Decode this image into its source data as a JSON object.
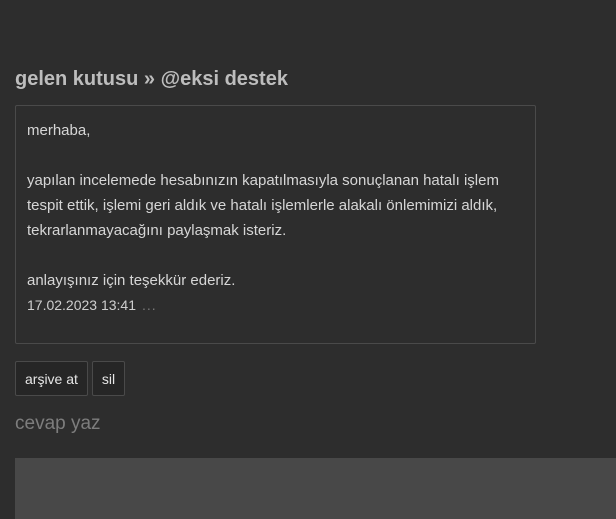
{
  "header": {
    "title": "gelen kutusu » @eksi destek"
  },
  "message": {
    "greeting": "merhaba,",
    "body_lines": [
      "yapılan incelemede hesabınızın kapatılmasıyla sonuçlanan hatalı işlem",
      "tespit ettik, işlemi geri aldık ve hatalı işlemlerle alakalı önlemimizi aldık,",
      "tekrarlanmayacağını paylaşmak isteriz."
    ],
    "closing": "anlayışınız için teşekkür ederiz.",
    "timestamp": "17.02.2023 13:41",
    "more": "..."
  },
  "actions": {
    "archive_label": "arşive at",
    "delete_label": "sil"
  },
  "reply": {
    "heading": "cevap yaz"
  }
}
